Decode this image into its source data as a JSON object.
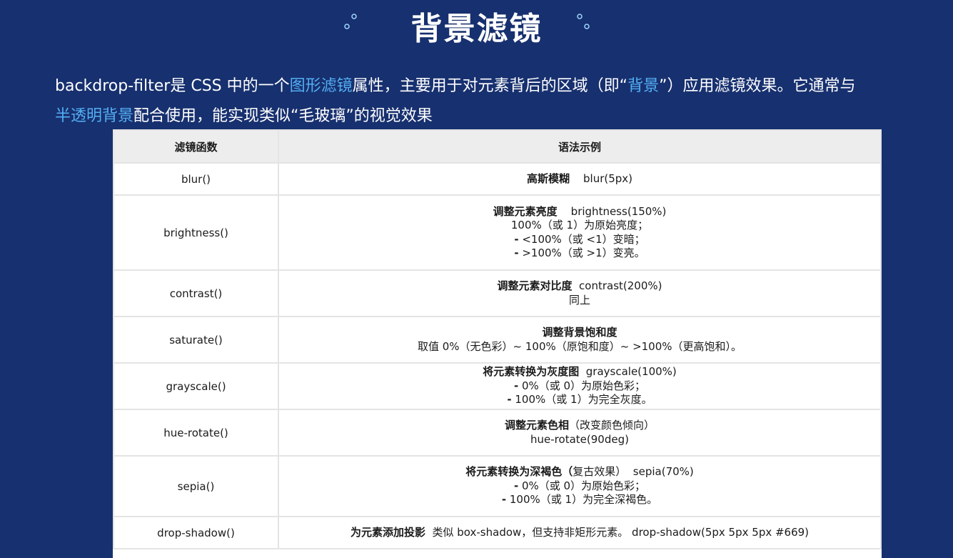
{
  "page_title": "背景滤镜",
  "intro": {
    "p1": "backdrop-filter是 CSS 中的一个",
    "h1": "图形滤镜",
    "p2": "属性，主要用于对元素背后的区域（即“",
    "h2": "背景",
    "p3": "”）应用滤镜效果。它通常与",
    "h3": "半透明背景",
    "p4": "配合使用，能实现类似“毛玻璃”的视觉效果"
  },
  "colors": {
    "background": "#17306f",
    "highlight": "#53aef3",
    "header_bg": "#ededed"
  },
  "table": {
    "headers": [
      "滤镜函数",
      "语法示例"
    ],
    "rows": [
      {
        "fn": "blur()",
        "lines": [
          {
            "bold": "高斯模糊",
            "text": "    blur(5px)"
          }
        ]
      },
      {
        "fn": "brightness()",
        "lines": [
          {
            "bold": "调整元素亮度",
            "text": "    brightness(150%)"
          },
          {
            "bold": "",
            "text": "100%（或 1）为原始亮度；"
          },
          {
            "bold": "-",
            "text": " <100%（或 <1）变暗；"
          },
          {
            "bold": "-",
            "text": " >100%（或 >1）变亮。"
          }
        ]
      },
      {
        "fn": "contrast()",
        "lines": [
          {
            "bold": "调整元素对比度",
            "text": "  contrast(200%)"
          },
          {
            "bold": "",
            "text": "同上"
          }
        ]
      },
      {
        "fn": "saturate()",
        "lines": [
          {
            "bold": "调整背景饱和度",
            "text": ""
          },
          {
            "bold": "",
            "text": "取值 0%（无色彩）~ 100%（原饱和度）~ >100%（更高饱和）。"
          }
        ]
      },
      {
        "fn": "grayscale()",
        "lines": [
          {
            "bold": "将元素转换为灰度图",
            "text": "  grayscale(100%)"
          },
          {
            "bold": "-",
            "text": " 0%（或 0）为原始色彩；"
          },
          {
            "bold": "-",
            "text": " 100%（或 1）为完全灰度。"
          }
        ]
      },
      {
        "fn": "hue-rotate()",
        "lines": [
          {
            "bold": "调整元素色相",
            "text": "（改变颜色倾向）"
          },
          {
            "bold": "",
            "text": "hue-rotate(90deg)"
          }
        ]
      },
      {
        "fn": "sepia()",
        "lines": [
          {
            "bold": "将元素转换为深褐色（",
            "text": "复古效果）  sepia(70%)"
          },
          {
            "bold": "-",
            "text": " 0%（或 0）为原始色彩；"
          },
          {
            "bold": "-",
            "text": " 100%（或 1）为完全深褐色。"
          }
        ]
      },
      {
        "fn": "drop-shadow()",
        "lines": [
          {
            "bold": "为元素添加投影",
            "text": "  类似 box-shadow，但支持非矩形元素。 drop-shadow(5px 5px 5px #669)"
          }
        ]
      }
    ]
  }
}
